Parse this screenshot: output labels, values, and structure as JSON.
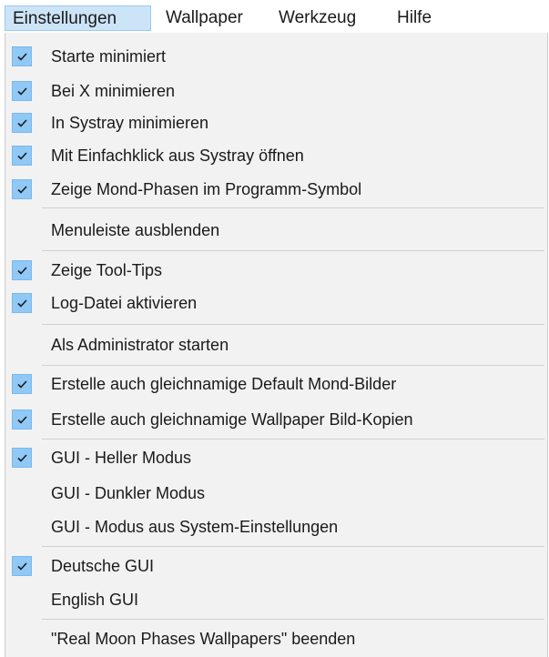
{
  "menubar": {
    "items": [
      {
        "label": "Einstellungen",
        "active": true
      },
      {
        "label": "Wallpaper",
        "active": false
      },
      {
        "label": "Werkzeug",
        "active": false
      },
      {
        "label": "Hilfe",
        "active": false
      }
    ]
  },
  "menu": {
    "items": [
      {
        "label": "Starte minimiert",
        "checked": true
      },
      {
        "label": "Bei X minimieren",
        "checked": true
      },
      {
        "label": "In Systray minimieren",
        "checked": true
      },
      {
        "label": "Mit Einfachklick aus Systray öffnen",
        "checked": true
      },
      {
        "label": "Zeige Mond-Phasen im Programm-Symbol",
        "checked": true
      },
      {
        "label": "Menuleiste ausblenden",
        "checked": false
      },
      {
        "label": "Zeige Tool-Tips",
        "checked": true
      },
      {
        "label": "Log-Datei aktivieren",
        "checked": true
      },
      {
        "label": "Als Administrator starten",
        "checked": false
      },
      {
        "label": "Erstelle auch gleichnamige Default Mond-Bilder",
        "checked": true
      },
      {
        "label": "Erstelle auch gleichnamige Wallpaper Bild-Kopien",
        "checked": true
      },
      {
        "label": "GUI - Heller Modus",
        "checked": true
      },
      {
        "label": "GUI - Dunkler Modus",
        "checked": false
      },
      {
        "label": "GUI - Modus aus System-Einstellungen",
        "checked": false
      },
      {
        "label": "Deutsche GUI",
        "checked": true
      },
      {
        "label": "English GUI",
        "checked": false
      },
      {
        "label": "\"Real Moon Phases Wallpapers\" beenden",
        "checked": false
      }
    ]
  },
  "colors": {
    "menubar_highlight": "#cce4f7",
    "menu_background": "#f2f2f2",
    "check_background": "#90c8f6"
  }
}
